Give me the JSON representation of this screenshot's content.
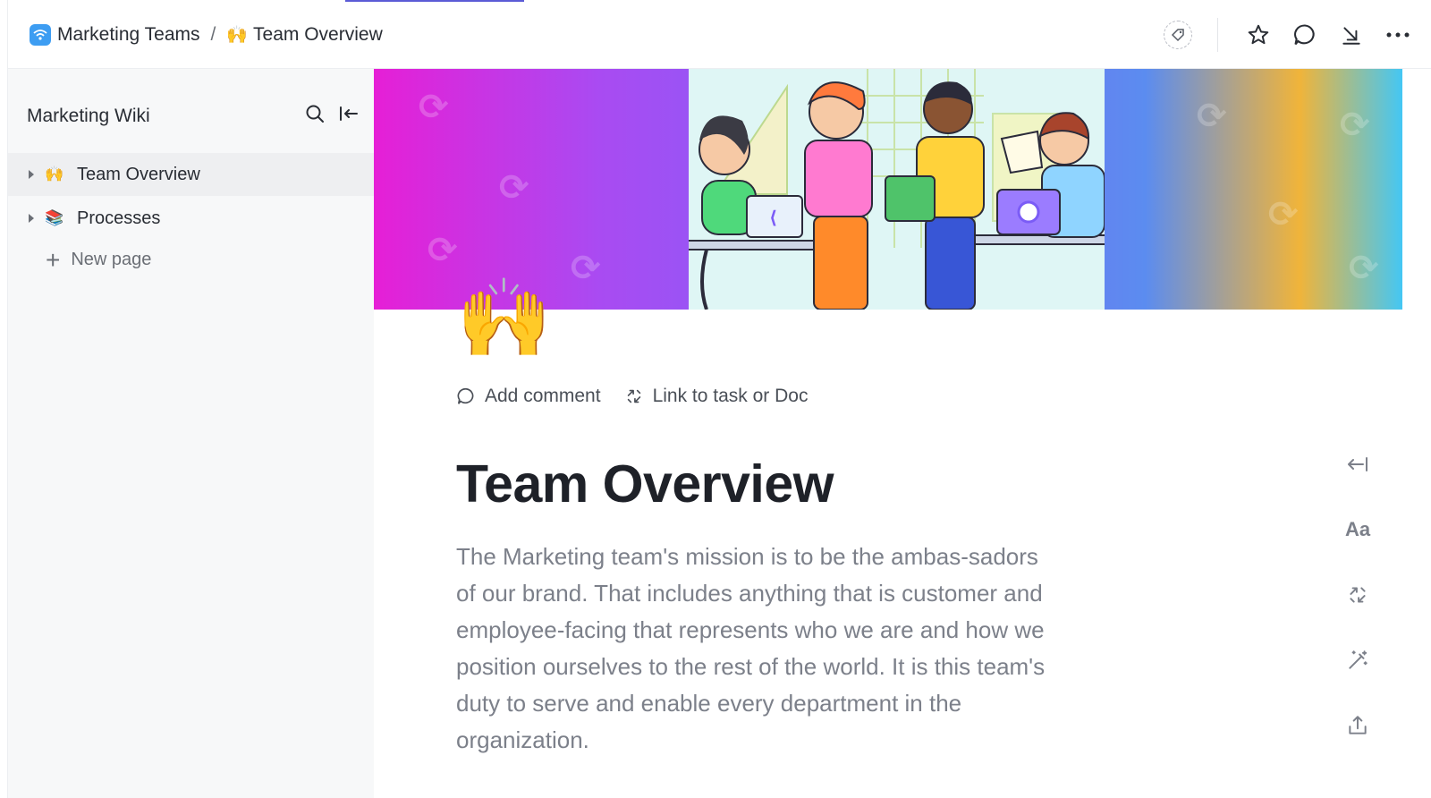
{
  "header": {
    "space_name": "Marketing Teams",
    "separator": "/",
    "page_emoji": "🙌",
    "page_name": "Team Overview"
  },
  "sidebar": {
    "title": "Marketing Wiki",
    "items": [
      {
        "emoji": "🙌",
        "label": "Team Overview"
      },
      {
        "emoji": "📚",
        "label": "Processes"
      }
    ],
    "new_page_label": "New page"
  },
  "main": {
    "page_emoji": "🙌",
    "add_comment_label": "Add comment",
    "link_label": "Link to task or Doc",
    "title": "Team Overview",
    "body": "The Marketing team's mission is to be the ambas-sadors of our brand. That includes anything that is customer and employee-facing that represents who we are and how we position ourselves to the rest of the world. It is this team's duty to serve and enable every department in the organization.",
    "rail_text_icon": "Aa"
  },
  "icons": {
    "space": "wifi-icon",
    "tag": "tag-icon",
    "favorite": "star-icon",
    "comments": "comment-icon",
    "minimize": "arrow-down-right-icon",
    "more": "more-dots-icon",
    "search": "search-icon",
    "collapse": "collapse-sidebar-icon"
  },
  "colors": {
    "accent": "#5b5bd6",
    "space_icon": "#3d9df2",
    "sidebar_bg": "#f7f8f9"
  }
}
